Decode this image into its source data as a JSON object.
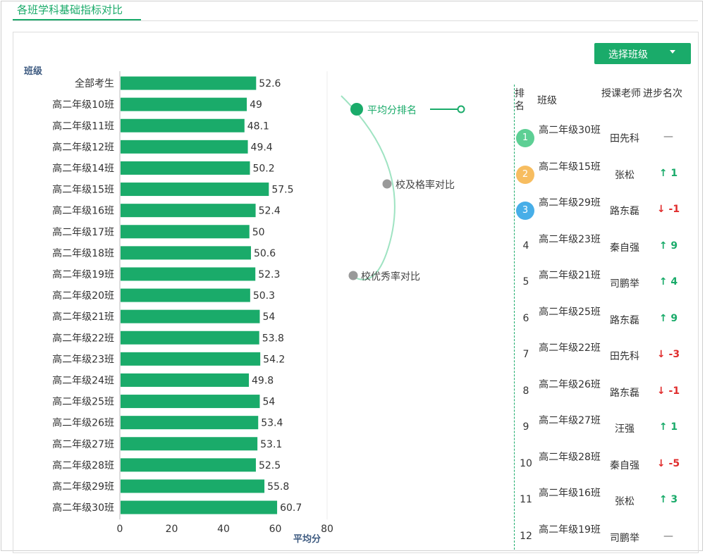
{
  "header": {
    "tab_title": "各班学科基础指标对比"
  },
  "select_button": {
    "label": "选择班级"
  },
  "chart_data": {
    "type": "bar",
    "orientation": "horizontal",
    "ylabel": "班级",
    "xlabel": "平均分",
    "categories": [
      "全部考生",
      "高二年级10班",
      "高二年级11班",
      "高二年级12班",
      "高二年级14班",
      "高二年级15班",
      "高二年级16班",
      "高二年级17班",
      "高二年级18班",
      "高二年级19班",
      "高二年级20班",
      "高二年级21班",
      "高二年级22班",
      "高二年级23班",
      "高二年级24班",
      "高二年级25班",
      "高二年级26班",
      "高二年级27班",
      "高二年级28班",
      "高二年级29班",
      "高二年级30班"
    ],
    "values": [
      52.6,
      49,
      48.1,
      49.4,
      50.2,
      57.5,
      52.4,
      50,
      50.6,
      52.3,
      50.3,
      54,
      53.8,
      54.2,
      49.8,
      54,
      53.4,
      53.1,
      52.5,
      55.8,
      60.7
    ],
    "xticks": [
      0,
      20,
      40,
      60,
      80
    ],
    "xlim": [
      0,
      80
    ],
    "bar_color": "#1aab6a"
  },
  "timeline": {
    "items": [
      {
        "label": "平均分排名",
        "active": true
      },
      {
        "label": "校及格率对比",
        "active": false
      },
      {
        "label": "校优秀率对比",
        "active": false
      }
    ]
  },
  "ranking": {
    "headers": {
      "rank": "排名",
      "class": "班级",
      "teacher": "授课老师",
      "progress": "进步名次"
    },
    "rows": [
      {
        "rank": "1",
        "class": "高二年级30班",
        "teacher": "田先科",
        "progress": "—",
        "dir": "flat"
      },
      {
        "rank": "2",
        "class": "高二年级15班",
        "teacher": "张松",
        "progress": "1",
        "dir": "up"
      },
      {
        "rank": "3",
        "class": "高二年级29班",
        "teacher": "路东磊",
        "progress": "-1",
        "dir": "down"
      },
      {
        "rank": "4",
        "class": "高二年级23班",
        "teacher": "秦自强",
        "progress": "9",
        "dir": "up"
      },
      {
        "rank": "5",
        "class": "高二年级21班",
        "teacher": "司鹏举",
        "progress": "4",
        "dir": "up"
      },
      {
        "rank": "6",
        "class": "高二年级25班",
        "teacher": "路东磊",
        "progress": "9",
        "dir": "up"
      },
      {
        "rank": "7",
        "class": "高二年级22班",
        "teacher": "田先科",
        "progress": "-3",
        "dir": "down"
      },
      {
        "rank": "8",
        "class": "高二年级26班",
        "teacher": "路东磊",
        "progress": "-1",
        "dir": "down"
      },
      {
        "rank": "9",
        "class": "高二年级27班",
        "teacher": "汪强",
        "progress": "1",
        "dir": "up"
      },
      {
        "rank": "10",
        "class": "高二年级28班",
        "teacher": "秦自强",
        "progress": "-5",
        "dir": "down"
      },
      {
        "rank": "11",
        "class": "高二年级16班",
        "teacher": "张松",
        "progress": "3",
        "dir": "up"
      },
      {
        "rank": "12",
        "class": "高二年级19班",
        "teacher": "司鹏举",
        "progress": "—",
        "dir": "flat"
      }
    ],
    "medal_colors": [
      "#5dcf94",
      "#f7bd60",
      "#47aee8"
    ]
  }
}
